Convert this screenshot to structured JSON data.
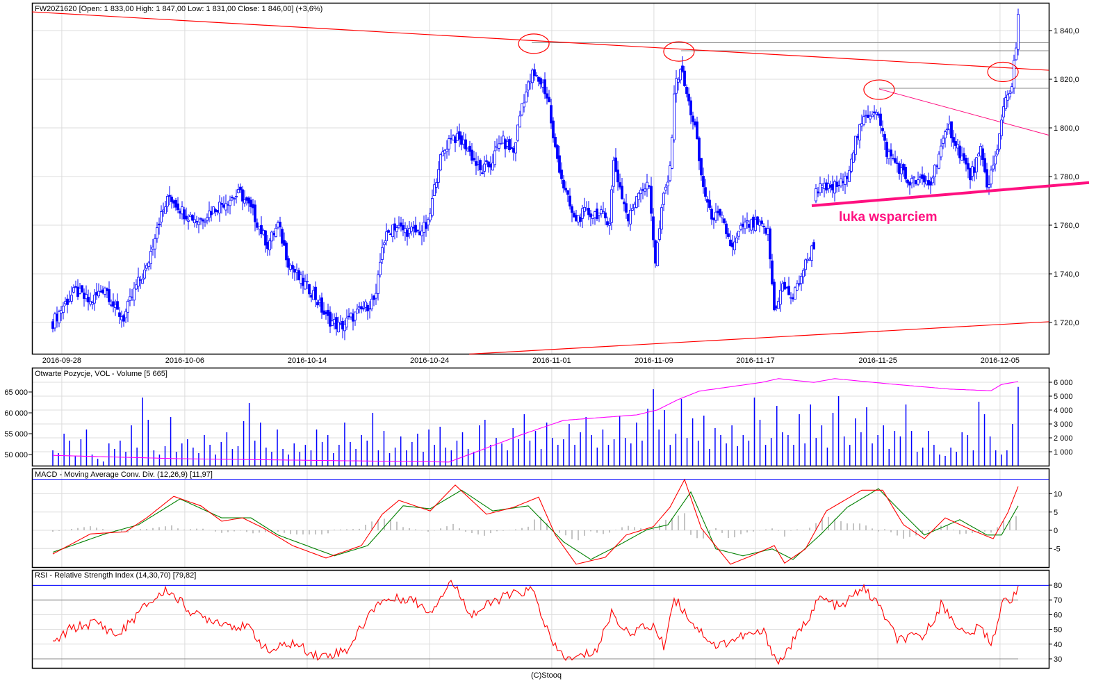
{
  "header": {
    "title": "FW20Z1620 [Open: 1 833,00  High: 1 847,00  Low: 1 831,00  Close: 1 846,00] (+3,6%)"
  },
  "footer": {
    "credit": "(C)Stooq"
  },
  "colors": {
    "candle": "#0000ff",
    "trend": "#ff0000",
    "support": "#ff1080",
    "oi": "#ff00ff",
    "macd": "#ff0000",
    "signal": "#008000",
    "hist": "#888888",
    "rsi": "#ff0000",
    "level": "#0000ff"
  },
  "chart_data": [
    {
      "type": "candlestick",
      "title": "FW20Z1620 [Open: 1 833,00  High: 1 847,00  Low: 1 831,00  Close: 1 846,00] (+3,6%)",
      "x_unit": "bar",
      "xlim": [
        -10,
        478
      ],
      "ylim": [
        1707,
        1852
      ],
      "y_ticks": [
        {
          "v": 1720,
          "label": "1 720,0"
        },
        {
          "v": 1740,
          "label": "1 740,0"
        },
        {
          "v": 1760,
          "label": "1 760,0"
        },
        {
          "v": 1780,
          "label": "1 780,0"
        },
        {
          "v": 1800,
          "label": "1 800,0"
        },
        {
          "v": 1820,
          "label": "1 820,0"
        },
        {
          "v": 1840,
          "label": "1 840,0"
        }
      ],
      "x_ticks": [
        {
          "bar": 4.3,
          "label": "2016-09-28"
        },
        {
          "bar": 63.3,
          "label": "2016-10-06"
        },
        {
          "bar": 122,
          "label": "2016-10-14"
        },
        {
          "bar": 180.7,
          "label": "2016-10-24"
        },
        {
          "bar": 239.3,
          "label": "2016-11-01"
        },
        {
          "bar": 288.3,
          "label": "2016-11-09"
        },
        {
          "bar": 337,
          "label": "2016-11-17"
        },
        {
          "bar": 395.7,
          "label": "2016-11-25"
        },
        {
          "bar": 454.3,
          "label": "2016-12-05"
        }
      ],
      "close_keyframes": [
        [
          0,
          1720
        ],
        [
          5,
          1727
        ],
        [
          11,
          1733
        ],
        [
          18,
          1728
        ],
        [
          25,
          1735
        ],
        [
          30,
          1725
        ],
        [
          34,
          1722
        ],
        [
          40,
          1735
        ],
        [
          45,
          1742
        ],
        [
          50,
          1760
        ],
        [
          56,
          1772
        ],
        [
          63,
          1765
        ],
        [
          70,
          1762
        ],
        [
          76,
          1766
        ],
        [
          83,
          1770
        ],
        [
          90,
          1773
        ],
        [
          96,
          1765
        ],
        [
          103,
          1752
        ],
        [
          108,
          1760
        ],
        [
          113,
          1745
        ],
        [
          118,
          1738
        ],
        [
          125,
          1732
        ],
        [
          131,
          1722
        ],
        [
          138,
          1718
        ],
        [
          143,
          1722
        ],
        [
          148,
          1725
        ],
        [
          155,
          1730
        ],
        [
          158,
          1752
        ],
        [
          163,
          1760
        ],
        [
          168,
          1758
        ],
        [
          175,
          1757
        ],
        [
          180,
          1760
        ],
        [
          185,
          1785
        ],
        [
          191,
          1797
        ],
        [
          198,
          1793
        ],
        [
          205,
          1782
        ],
        [
          210,
          1785
        ],
        [
          215,
          1795
        ],
        [
          221,
          1790
        ],
        [
          225,
          1810
        ],
        [
          230,
          1822
        ],
        [
          235,
          1818
        ],
        [
          238,
          1810
        ],
        [
          240,
          1795
        ],
        [
          245,
          1776
        ],
        [
          250,
          1762
        ],
        [
          255,
          1765
        ],
        [
          261,
          1765
        ],
        [
          267,
          1762
        ],
        [
          269,
          1786
        ],
        [
          273,
          1772
        ],
        [
          276,
          1762
        ],
        [
          281,
          1775
        ],
        [
          286,
          1776
        ],
        [
          289,
          1745
        ],
        [
          293,
          1772
        ],
        [
          296,
          1782
        ],
        [
          298,
          1815
        ],
        [
          301,
          1825
        ],
        [
          305,
          1810
        ],
        [
          308,
          1800
        ],
        [
          311,
          1780
        ],
        [
          315,
          1765
        ],
        [
          321,
          1762
        ],
        [
          326,
          1750
        ],
        [
          331,
          1760
        ],
        [
          338,
          1760
        ],
        [
          343,
          1757
        ],
        [
          346,
          1725
        ],
        [
          350,
          1735
        ],
        [
          355,
          1730
        ],
        [
          360,
          1742
        ],
        [
          365,
          1752
        ],
        [
          366,
          1775
        ],
        [
          373,
          1775
        ],
        [
          380,
          1778
        ],
        [
          385,
          1795
        ],
        [
          390,
          1805
        ],
        [
          395,
          1808
        ],
        [
          400,
          1790
        ],
        [
          405,
          1785
        ],
        [
          410,
          1778
        ],
        [
          416,
          1778
        ],
        [
          421,
          1777
        ],
        [
          425,
          1790
        ],
        [
          430,
          1800
        ],
        [
          435,
          1790
        ],
        [
          440,
          1780
        ],
        [
          445,
          1790
        ],
        [
          448,
          1776
        ],
        [
          453,
          1790
        ],
        [
          456,
          1810
        ],
        [
          460,
          1818
        ],
        [
          462,
          1833
        ],
        [
          463,
          1846
        ]
      ],
      "annotations": {
        "label": "luka wsparciem",
        "resistance_line": [
          [
            -10,
            1847.7
          ],
          [
            477.7,
            1823.7
          ]
        ],
        "lower_line": [
          [
            199.7,
            1707
          ],
          [
            477.7,
            1720.3
          ]
        ],
        "support_line": [
          [
            364,
            1768
          ],
          [
            497,
            1777.5
          ]
        ],
        "descending_line": [
          [
            396.3,
            1816
          ],
          [
            477.7,
            1797
          ]
        ],
        "horizontal_levels": [
          {
            "from": 229.7,
            "price": 1835
          },
          {
            "from": 301.3,
            "price": 1831.7
          },
          {
            "from": 396.3,
            "price": 1816.3
          }
        ],
        "circled_points": [
          [
            230.7,
            1834.6
          ],
          [
            300.3,
            1831.4
          ],
          [
            396.3,
            1815.7
          ],
          [
            455.7,
            1823
          ]
        ]
      }
    },
    {
      "type": "bar+line",
      "title": "Otwarte Pozycje, VOL - Volume [5 665]",
      "volume_ticks": [
        {
          "v": 1000,
          "label": "1 000"
        },
        {
          "v": 2000,
          "label": "2 000"
        },
        {
          "v": 3000,
          "label": "3 000"
        },
        {
          "v": 4000,
          "label": "4 000"
        },
        {
          "v": 5000,
          "label": "5 000"
        },
        {
          "v": 6000,
          "label": "6 000"
        }
      ],
      "oi_ticks": [
        {
          "v": 50000,
          "label": "50 000"
        },
        {
          "v": 55000,
          "label": "55 000"
        },
        {
          "v": 60000,
          "label": "60 000"
        },
        {
          "v": 65000,
          "label": "65 000"
        }
      ],
      "volume": [
        1100,
        900,
        2300,
        1800,
        700,
        1900,
        2600,
        800,
        500,
        300,
        1600,
        1200,
        1800,
        1000,
        2900,
        1300,
        4900,
        3300,
        1100,
        800,
        1400,
        3500,
        1000,
        1600,
        1900,
        1300,
        900,
        2200,
        1500,
        800,
        1700,
        2400,
        1200,
        1400,
        3200,
        4500,
        1800,
        3100,
        1300,
        1000,
        2600,
        1200,
        800,
        1600,
        1000,
        1500,
        1100,
        2600,
        1700,
        2200,
        900,
        1500,
        3100,
        1700,
        1200,
        2200,
        1800,
        3800,
        1100,
        2500,
        900,
        1300,
        2100,
        1100,
        1700,
        2300,
        1000,
        2600,
        1500,
        2800,
        1300,
        1100,
        1800,
        2400,
        1200,
        1000,
        2900,
        3300,
        1500,
        2000,
        1600,
        1100,
        2700,
        1900,
        3700,
        1800,
        2500,
        1200,
        3100,
        2000,
        1500,
        1900,
        3000,
        1500,
        2400,
        3500,
        2200,
        1300,
        2600,
        1500,
        1900,
        3600,
        2000,
        1600,
        3100,
        1800,
        4100,
        5500,
        2600,
        4000,
        1500,
        2300,
        4800,
        2000,
        3400,
        1800,
        3600,
        1200,
        2700,
        2200,
        1600,
        2900,
        1400,
        2200,
        1800,
        4900,
        3300,
        1500,
        2000,
        4300,
        2400,
        2200,
        1500,
        3700,
        1600,
        4400,
        2000,
        2900,
        1300,
        3800,
        5000,
        2100,
        1500,
        3400,
        2400,
        4200,
        1600,
        2200,
        2900,
        1200,
        2500,
        2100,
        4400,
        2500,
        1000,
        1300,
        2500,
        1500,
        800,
        700,
        1300,
        1000,
        2400,
        2200,
        1100,
        4600,
        3700,
        2100,
        1100,
        800,
        1100,
        3000,
        5665
      ],
      "open_interest_keyframes": [
        [
          0,
          49800
        ],
        [
          60,
          49000
        ],
        [
          110,
          48700
        ],
        [
          190,
          48200
        ],
        [
          205,
          51000
        ],
        [
          225,
          54800
        ],
        [
          245,
          58200
        ],
        [
          280,
          59500
        ],
        [
          290,
          60700
        ],
        [
          300,
          63200
        ],
        [
          310,
          65200
        ],
        [
          340,
          67300
        ],
        [
          348,
          68200
        ],
        [
          365,
          67300
        ],
        [
          375,
          68200
        ],
        [
          400,
          67000
        ],
        [
          430,
          65700
        ],
        [
          450,
          65300
        ],
        [
          455,
          66800
        ],
        [
          463,
          67500
        ]
      ]
    },
    {
      "type": "line",
      "title": "MACD - Moving Average Conv. Div. (12,26,9) [11,97]",
      "ylim": [
        -10,
        16
      ],
      "y_ticks": [
        {
          "v": -5,
          "label": "-5"
        },
        {
          "v": 0,
          "label": "0"
        },
        {
          "v": 5,
          "label": "5"
        },
        {
          "v": 10,
          "label": "10"
        }
      ],
      "upper_level": 14,
      "macd_keyframes": [
        [
          0,
          -6.5
        ],
        [
          18,
          -1
        ],
        [
          35,
          -0.4
        ],
        [
          45,
          3.4
        ],
        [
          58,
          9.3
        ],
        [
          71,
          6.7
        ],
        [
          81,
          2.5
        ],
        [
          91,
          3.4
        ],
        [
          101,
          0.6
        ],
        [
          115,
          -4.2
        ],
        [
          131,
          -7.6
        ],
        [
          148,
          -4.2
        ],
        [
          158,
          4.4
        ],
        [
          166,
          8.2
        ],
        [
          181,
          5.3
        ],
        [
          193,
          12.4
        ],
        [
          208,
          4.4
        ],
        [
          221,
          6.3
        ],
        [
          233,
          9.1
        ],
        [
          241,
          -1.3
        ],
        [
          251,
          -9.3
        ],
        [
          265,
          -7.4
        ],
        [
          275,
          -1.3
        ],
        [
          288,
          1
        ],
        [
          296,
          6.3
        ],
        [
          303,
          13.9
        ],
        [
          311,
          0.6
        ],
        [
          325,
          -9.3
        ],
        [
          335,
          -7
        ],
        [
          346,
          -4.2
        ],
        [
          351,
          -9
        ],
        [
          361,
          -5.1
        ],
        [
          371,
          5.3
        ],
        [
          388,
          11
        ],
        [
          398,
          11
        ],
        [
          408,
          1.5
        ],
        [
          418,
          -2.3
        ],
        [
          428,
          3.4
        ],
        [
          441,
          0
        ],
        [
          451,
          -2.3
        ],
        [
          458,
          4.8
        ],
        [
          463,
          12
        ]
      ],
      "signal_keyframes": [
        [
          0,
          -6
        ],
        [
          25,
          -1
        ],
        [
          41,
          1.5
        ],
        [
          61,
          8.6
        ],
        [
          81,
          3.4
        ],
        [
          95,
          3.4
        ],
        [
          108,
          -1.3
        ],
        [
          135,
          -7
        ],
        [
          151,
          -4.2
        ],
        [
          168,
          6.7
        ],
        [
          181,
          5.9
        ],
        [
          196,
          11
        ],
        [
          211,
          5.3
        ],
        [
          228,
          6.7
        ],
        [
          245,
          -3.2
        ],
        [
          258,
          -8
        ],
        [
          271,
          -4.2
        ],
        [
          285,
          0.2
        ],
        [
          295,
          1.5
        ],
        [
          306,
          10.5
        ],
        [
          318,
          -5.1
        ],
        [
          331,
          -7
        ],
        [
          345,
          -5.1
        ],
        [
          355,
          -8
        ],
        [
          368,
          -1.3
        ],
        [
          381,
          6.3
        ],
        [
          396,
          11.4
        ],
        [
          408,
          4.4
        ],
        [
          418,
          -1.3
        ],
        [
          435,
          2.9
        ],
        [
          448,
          -1.3
        ],
        [
          455,
          -1.3
        ],
        [
          463,
          6.7
        ]
      ]
    },
    {
      "type": "line",
      "title": "RSI - Relative Strength Index (14,30,70) [79,82]",
      "ylim": [
        24,
        90
      ],
      "y_ticks": [
        {
          "v": 30,
          "label": "30"
        },
        {
          "v": 40,
          "label": "40"
        },
        {
          "v": 50,
          "label": "50"
        },
        {
          "v": 60,
          "label": "60"
        },
        {
          "v": 70,
          "label": "70"
        },
        {
          "v": 80,
          "label": "80"
        }
      ],
      "levels": [
        30,
        70
      ],
      "current_level": 79.82,
      "rsi_keyframes": [
        [
          0,
          39.4
        ],
        [
          8,
          50
        ],
        [
          21,
          55
        ],
        [
          31,
          45.6
        ],
        [
          45,
          66.8
        ],
        [
          55,
          77
        ],
        [
          68,
          60
        ],
        [
          81,
          55
        ],
        [
          95,
          50
        ],
        [
          103,
          34.7
        ],
        [
          115,
          40.8
        ],
        [
          128,
          31.4
        ],
        [
          141,
          36
        ],
        [
          156,
          69
        ],
        [
          171,
          71.5
        ],
        [
          181,
          62
        ],
        [
          191,
          83
        ],
        [
          201,
          60
        ],
        [
          215,
          71.5
        ],
        [
          230,
          77
        ],
        [
          240,
          38.5
        ],
        [
          248,
          29
        ],
        [
          261,
          36
        ],
        [
          268,
          62
        ],
        [
          275,
          48
        ],
        [
          288,
          52.6
        ],
        [
          293,
          38.5
        ],
        [
          298,
          71.5
        ],
        [
          308,
          52.6
        ],
        [
          318,
          38.5
        ],
        [
          331,
          45.6
        ],
        [
          341,
          48
        ],
        [
          348,
          26.7
        ],
        [
          358,
          48
        ],
        [
          368,
          71.5
        ],
        [
          378,
          64.4
        ],
        [
          388,
          78.6
        ],
        [
          396,
          66.8
        ],
        [
          405,
          43
        ],
        [
          418,
          45.6
        ],
        [
          426,
          66.8
        ],
        [
          438,
          45.6
        ],
        [
          445,
          51.7
        ],
        [
          450,
          40.8
        ],
        [
          456,
          69
        ],
        [
          460,
          71.5
        ],
        [
          463,
          80
        ]
      ]
    }
  ]
}
